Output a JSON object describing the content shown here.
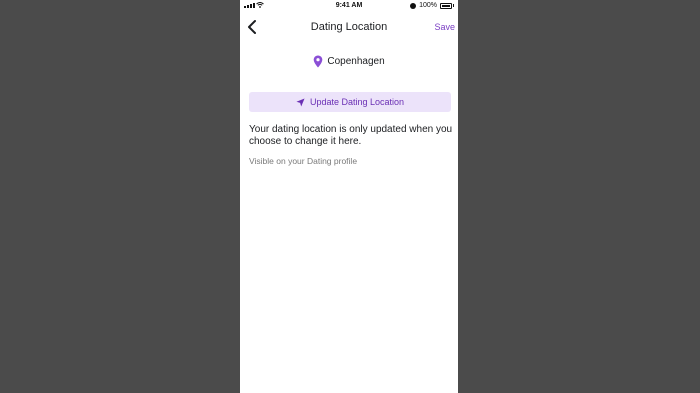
{
  "status_bar": {
    "time": "9:41 AM",
    "battery": "100%"
  },
  "header": {
    "title": "Dating Location",
    "save_label": "Save",
    "back_icon": "chevron-left-icon"
  },
  "location": {
    "icon": "map-pin-icon",
    "name": "Copenhagen"
  },
  "update_button": {
    "icon": "navigation-arrow-icon",
    "label": "Update Dating Location"
  },
  "description": "Your dating location is only updated when you choose to change it here.",
  "visibility_note": "Visible on your Dating profile",
  "colors": {
    "accent": "#7b3fc4",
    "button_bg": "#ece3fa",
    "background": "#4b4b4b"
  }
}
